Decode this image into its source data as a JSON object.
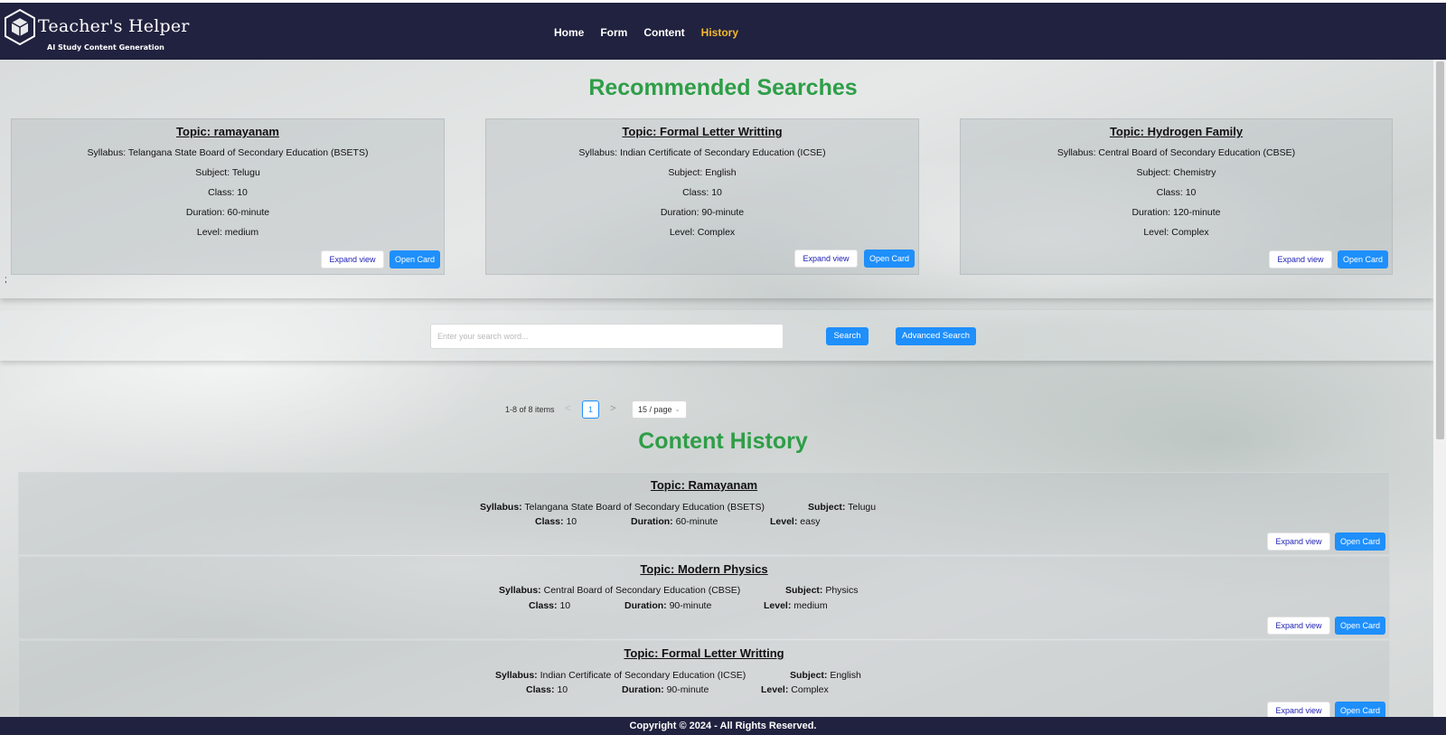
{
  "header": {
    "logo_title": "Teacher's Helper",
    "logo_subtitle": "AI Study Content Generation",
    "nav": [
      {
        "label": "Home"
      },
      {
        "label": "Form"
      },
      {
        "label": "Content"
      },
      {
        "label": "History"
      }
    ],
    "active_nav": "History"
  },
  "recommended": {
    "title": "Recommended Searches",
    "cards": [
      {
        "topic": "Topic: ramayanam",
        "syllabus": "Syllabus: Telangana State Board of Secondary Education (BSETS)",
        "subject": "Subject: Telugu",
        "class": "Class: 10",
        "duration": "Duration: 60-minute",
        "level": "Level: medium",
        "expand_label": "Expand view",
        "open_label": "Open Card"
      },
      {
        "topic": "Topic: Formal Letter Writting",
        "syllabus": "Syllabus: Indian Certificate of Secondary Education (ICSE)",
        "subject": "Subject: English",
        "class": "Class: 10",
        "duration": "Duration: 90-minute",
        "level": "Level: Complex",
        "expand_label": "Expand view",
        "open_label": "Open Card"
      },
      {
        "topic": "Topic: Hydrogen Family",
        "syllabus": "Syllabus: Central Board of Secondary Education (CBSE)",
        "subject": "Subject: Chemistry",
        "class": "Class: 10",
        "duration": "Duration: 120-minute",
        "level": "Level: Complex",
        "expand_label": "Expand view",
        "open_label": "Open Card"
      }
    ],
    "stray_text": ";"
  },
  "search": {
    "placeholder": "Enter your search word...",
    "search_label": "Search",
    "advanced_label": "Advanced Search"
  },
  "pagination": {
    "total_text": "1-8 of 8 items",
    "prev": "<",
    "current_page": "1",
    "next": ">",
    "page_size": "15 / page"
  },
  "history": {
    "title": "Content History",
    "labels": {
      "syllabus": "Syllabus:",
      "subject": "Subject:",
      "class": "Class:",
      "duration": "Duration:",
      "level": "Level:"
    },
    "items": [
      {
        "topic": "Topic: Ramayanam",
        "syllabus": "Telangana State Board of Secondary Education (BSETS)",
        "subject": "Telugu",
        "class": "10",
        "duration": "60-minute",
        "level": "easy",
        "expand_label": "Expand view",
        "open_label": "Open Card"
      },
      {
        "topic": "Topic: Modern Physics",
        "syllabus": "Central Board of Secondary Education (CBSE)",
        "subject": "Physics",
        "class": "10",
        "duration": "90-minute",
        "level": "medium",
        "expand_label": "Expand view",
        "open_label": "Open Card"
      },
      {
        "topic": "Topic: Formal Letter Writting",
        "syllabus": "Indian Certificate of Secondary Education (ICSE)",
        "subject": "English",
        "class": "10",
        "duration": "90-minute",
        "level": "Complex",
        "expand_label": "Expand view",
        "open_label": "Open Card"
      }
    ]
  },
  "footer": {
    "text": "Copyright © 2024 - All Rights Reserved."
  },
  "colors": {
    "navbar": "#21223f",
    "nav_active": "#f5b82e",
    "section_title": "#2e9e47",
    "primary_button": "#1e8ffb",
    "expand_text": "#1b1bb3"
  }
}
